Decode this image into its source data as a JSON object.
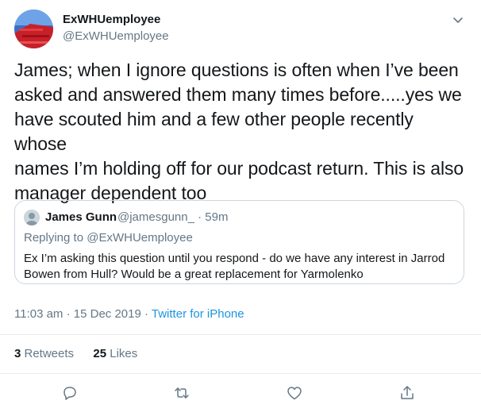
{
  "author": {
    "name": "ExWHUemployee",
    "handle": "@ExWHUemployee"
  },
  "tweet": {
    "text": "James; when I ignore questions is often when I’ve been\nasked and answered them many times before.....yes we\nhave scouted him and a few other people recently whose\nnames I’m holding off for our podcast return. This is also\nmanager dependent too"
  },
  "quoted_tweet": {
    "name": "James Gunn",
    "handle_time": "@jamesgunn_ · 59m",
    "replying_prefix": "Replying to ",
    "replying_handle": "@ExWHUemployee",
    "text": "Ex I’m asking this question until you respond - do we have any interest in Jarrod\nBowen from Hull? Would be a great replacement for Yarmolenko"
  },
  "meta": {
    "timestamp": "11:03 am · 15 Dec 2019 · ",
    "source": "Twitter for iPhone"
  },
  "stats": {
    "retweets_count": "3",
    "retweets_label": " Retweets",
    "likes_count": "25",
    "likes_label": " Likes"
  },
  "icons": {
    "caret": "chevron-down-icon",
    "reply": "reply-icon",
    "retweet": "retweet-icon",
    "like": "heart-icon",
    "share": "share-icon"
  },
  "colors": {
    "link": "#1b95e0",
    "secondary_text": "#657786",
    "primary_text": "#14171a",
    "border": "#ccd6dd"
  }
}
